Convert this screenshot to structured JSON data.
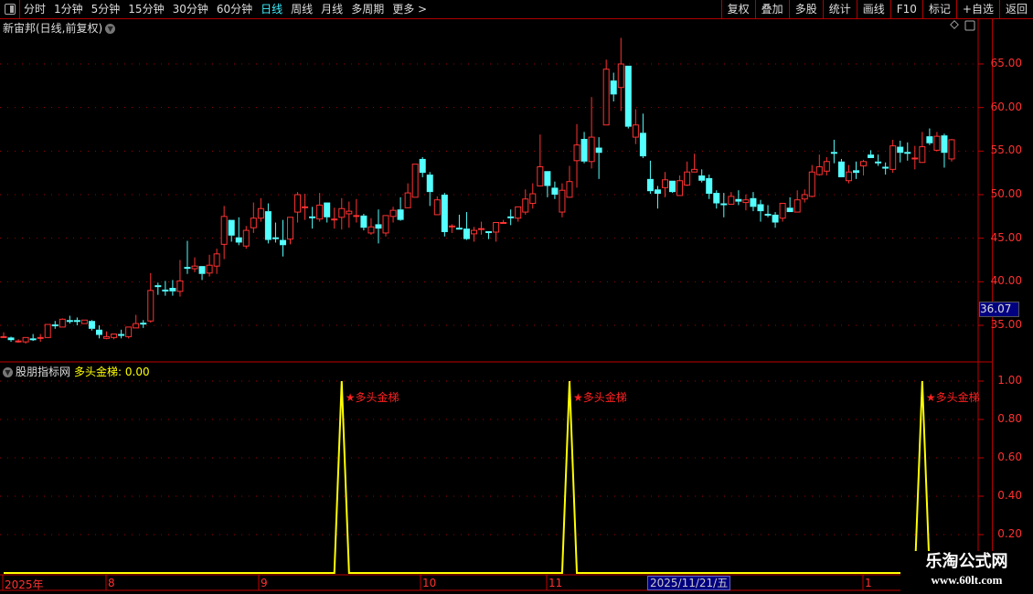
{
  "toolbar": {
    "periods": [
      "分时",
      "1分钟",
      "5分钟",
      "15分钟",
      "30分钟",
      "60分钟",
      "日线",
      "周线",
      "月线",
      "多周期",
      "更多 >"
    ],
    "active_period": "日线",
    "right_buttons": [
      "复权",
      "叠加",
      "多股",
      "统计",
      "画线",
      "F10",
      "标记",
      "+自选",
      "返回"
    ]
  },
  "main_chart": {
    "title": "新宙邦(日线,前复权)",
    "price_ticks": [
      "65.00",
      "60.00",
      "55.00",
      "50.00",
      "45.00",
      "40.00",
      "35.00"
    ],
    "current_price": "36.07",
    "up_color": "#ff3232",
    "down_color": "#54ffff"
  },
  "indicator": {
    "source": "股朋指标网",
    "name_value": "多头金梯: 0.00",
    "ticks": [
      "1.00",
      "0.80",
      "0.60",
      "0.40",
      "0.20"
    ],
    "signal_label": "★多头金梯",
    "line_color": "#ffff00"
  },
  "date_axis": {
    "labels": [
      "2025年",
      "8",
      "9",
      "10",
      "11",
      "1"
    ],
    "selected_date": "2025/11/21/五"
  },
  "watermark": {
    "line1": "乐淘公式网",
    "line2": "www.60lt.com"
  },
  "chart_data": {
    "type": "candlestick",
    "ylim": [
      31,
      69
    ],
    "candles_ohlc_order": "open,close,high,low",
    "candles": [
      [
        33.6,
        33.7,
        34.2,
        33.6
      ],
      [
        33.6,
        33.3,
        33.7,
        33.1
      ],
      [
        33.2,
        33.2,
        33.4,
        33.0
      ],
      [
        33.1,
        33.6,
        33.6,
        32.9
      ],
      [
        33.5,
        33.4,
        34.0,
        33.2
      ],
      [
        33.5,
        33.6,
        34.0,
        33.1
      ],
      [
        33.6,
        35.1,
        35.1,
        33.6
      ],
      [
        35.1,
        35.0,
        35.5,
        34.6
      ],
      [
        34.8,
        35.7,
        35.8,
        34.8
      ],
      [
        35.6,
        35.5,
        36.1,
        35.2
      ],
      [
        35.6,
        35.5,
        35.9,
        35.0
      ],
      [
        35.2,
        35.6,
        35.6,
        35.2
      ],
      [
        35.5,
        34.6,
        35.6,
        34.4
      ],
      [
        34.5,
        33.9,
        35.0,
        33.5
      ],
      [
        33.5,
        33.7,
        34.3,
        33.4
      ],
      [
        33.6,
        34.0,
        34.0,
        33.4
      ],
      [
        34.0,
        33.9,
        34.5,
        33.5
      ],
      [
        33.7,
        34.8,
        34.8,
        33.5
      ],
      [
        34.7,
        35.2,
        36.2,
        34.7
      ],
      [
        35.3,
        35.2,
        35.6,
        34.7
      ],
      [
        35.5,
        39.0,
        41.0,
        35.3
      ],
      [
        39.6,
        39.5,
        39.9,
        38.5
      ],
      [
        39.1,
        39.0,
        40.1,
        38.4
      ],
      [
        39.3,
        38.9,
        40.2,
        38.4
      ],
      [
        38.9,
        40.1,
        42.5,
        38.3
      ],
      [
        41.7,
        41.6,
        44.7,
        40.9
      ],
      [
        41.5,
        41.8,
        42.8,
        41.1
      ],
      [
        41.8,
        40.9,
        41.8,
        40.2
      ],
      [
        41.0,
        41.9,
        43.1,
        40.6
      ],
      [
        41.8,
        43.2,
        43.8,
        40.9
      ],
      [
        44.3,
        47.5,
        48.7,
        42.6
      ],
      [
        47.1,
        45.3,
        47.1,
        44.6
      ],
      [
        45.1,
        44.5,
        47.4,
        44.2
      ],
      [
        44.1,
        45.9,
        46.4,
        43.8
      ],
      [
        46.2,
        47.3,
        49.1,
        45.6
      ],
      [
        47.3,
        48.4,
        49.6,
        46.9
      ],
      [
        48.1,
        44.8,
        49.0,
        44.4
      ],
      [
        45.1,
        45.0,
        46.8,
        44.5
      ],
      [
        44.8,
        44.2,
        47.1,
        42.9
      ],
      [
        44.9,
        47.4,
        47.4,
        44.3
      ],
      [
        48.0,
        50.0,
        50.3,
        46.8
      ],
      [
        48.5,
        48.6,
        50.1,
        47.1
      ],
      [
        47.5,
        47.4,
        48.6,
        46.1
      ],
      [
        47.2,
        48.8,
        50.2,
        46.9
      ],
      [
        49.1,
        47.4,
        49.1,
        46.8
      ],
      [
        47.1,
        47.2,
        48.5,
        46.1
      ],
      [
        47.4,
        48.4,
        49.6,
        46.0
      ],
      [
        47.8,
        48.1,
        49.2,
        46.2
      ],
      [
        47.5,
        47.6,
        49.5,
        46.8
      ],
      [
        47.6,
        46.2,
        47.8,
        45.9
      ],
      [
        45.6,
        46.3,
        47.3,
        45.4
      ],
      [
        46.6,
        46.1,
        48.3,
        44.4
      ],
      [
        45.6,
        47.6,
        47.6,
        45.2
      ],
      [
        47.5,
        48.2,
        48.6,
        46.8
      ],
      [
        48.3,
        47.1,
        49.7,
        47.0
      ],
      [
        48.5,
        50.2,
        51.3,
        48.5
      ],
      [
        49.7,
        53.5,
        53.5,
        49.7
      ],
      [
        54.1,
        52.5,
        54.3,
        52.0
      ],
      [
        52.3,
        50.3,
        52.6,
        48.7
      ],
      [
        47.7,
        49.4,
        49.8,
        47.7
      ],
      [
        50.0,
        45.7,
        50.2,
        45.2
      ],
      [
        46.3,
        46.4,
        46.6,
        45.6
      ],
      [
        46.2,
        46.1,
        47.7,
        46.0
      ],
      [
        46.1,
        44.9,
        48.0,
        44.8
      ],
      [
        45.5,
        45.9,
        46.3,
        44.6
      ],
      [
        46.0,
        46.1,
        46.9,
        45.4
      ],
      [
        45.8,
        45.7,
        45.8,
        44.9
      ],
      [
        45.7,
        46.8,
        46.8,
        44.6
      ],
      [
        46.7,
        46.8,
        47.1,
        46.7
      ],
      [
        47.5,
        47.4,
        48.3,
        46.5
      ],
      [
        47.3,
        48.6,
        48.6,
        46.9
      ],
      [
        48.0,
        49.5,
        50.6,
        47.7
      ],
      [
        49.0,
        50.1,
        51.3,
        48.4
      ],
      [
        51.0,
        53.2,
        56.9,
        51.0
      ],
      [
        52.7,
        51.0,
        52.7,
        49.7
      ],
      [
        50.8,
        50.0,
        51.5,
        49.5
      ],
      [
        48.0,
        50.5,
        51.3,
        47.4
      ],
      [
        49.7,
        51.5,
        53.3,
        49.7
      ],
      [
        53.9,
        55.7,
        58.1,
        50.8
      ],
      [
        56.4,
        53.8,
        57.2,
        53.6
      ],
      [
        53.8,
        56.6,
        61.2,
        53.0
      ],
      [
        55.4,
        54.8,
        56.6,
        51.8
      ],
      [
        58.0,
        64.4,
        65.5,
        58.0
      ],
      [
        63.1,
        61.5,
        64.0,
        60.7
      ],
      [
        62.3,
        65.0,
        68.0,
        59.6
      ],
      [
        64.8,
        57.8,
        64.8,
        57.6
      ],
      [
        56.6,
        58.0,
        59.8,
        55.8
      ],
      [
        57.1,
        54.4,
        59.3,
        54.2
      ],
      [
        51.8,
        50.4,
        53.9,
        50.1
      ],
      [
        50.6,
        50.1,
        51.0,
        48.4
      ],
      [
        50.8,
        51.7,
        52.6,
        49.7
      ],
      [
        51.6,
        50.3,
        51.6,
        50.2
      ],
      [
        49.9,
        51.6,
        52.2,
        49.9
      ],
      [
        51.1,
        52.6,
        53.8,
        51.0
      ],
      [
        52.6,
        52.9,
        54.7,
        52.6
      ],
      [
        52.2,
        51.6,
        52.9,
        51.4
      ],
      [
        51.9,
        50.1,
        52.3,
        49.5
      ],
      [
        50.2,
        49.0,
        50.5,
        48.4
      ],
      [
        49.0,
        48.9,
        50.2,
        47.4
      ],
      [
        48.9,
        49.8,
        50.3,
        48.9
      ],
      [
        49.5,
        49.2,
        50.5,
        48.8
      ],
      [
        49.1,
        49.4,
        50.0,
        48.2
      ],
      [
        49.6,
        48.6,
        50.3,
        48.1
      ],
      [
        48.9,
        48.1,
        49.4,
        46.9
      ],
      [
        47.8,
        47.7,
        48.8,
        47.4
      ],
      [
        47.7,
        46.8,
        48.0,
        46.2
      ],
      [
        47.3,
        49.0,
        49.0,
        46.9
      ],
      [
        48.5,
        48.0,
        49.7,
        48.0
      ],
      [
        48.0,
        49.4,
        50.5,
        48.0
      ],
      [
        49.5,
        50.0,
        50.6,
        49.1
      ],
      [
        49.8,
        52.6,
        53.4,
        49.7
      ],
      [
        52.3,
        53.2,
        54.6,
        52.2
      ],
      [
        52.7,
        53.8,
        54.3,
        52.2
      ],
      [
        54.9,
        54.8,
        56.3,
        53.6
      ],
      [
        53.8,
        52.0,
        54.1,
        52.0
      ],
      [
        51.6,
        52.6,
        53.4,
        51.3
      ],
      [
        52.8,
        52.5,
        53.8,
        51.8
      ],
      [
        53.3,
        53.8,
        54.0,
        52.2
      ],
      [
        54.6,
        54.2,
        55.1,
        54.2
      ],
      [
        53.8,
        53.7,
        54.6,
        53.3
      ],
      [
        53.2,
        53.1,
        53.7,
        52.3
      ],
      [
        52.9,
        55.6,
        56.3,
        52.5
      ],
      [
        55.5,
        54.8,
        56.2,
        53.7
      ],
      [
        54.9,
        54.8,
        56.0,
        53.9
      ],
      [
        54.1,
        54.2,
        55.6,
        52.9
      ],
      [
        53.7,
        55.5,
        57.2,
        53.7
      ],
      [
        56.7,
        55.9,
        57.6,
        55.7
      ],
      [
        55.1,
        56.7,
        57.2,
        55.0
      ],
      [
        56.8,
        54.8,
        57.0,
        53.1
      ],
      [
        54.1,
        56.3,
        56.4,
        53.8
      ]
    ],
    "indicator_signal_indices": [
      46,
      77,
      125
    ],
    "indicator_ylim": [
      0,
      1
    ]
  }
}
